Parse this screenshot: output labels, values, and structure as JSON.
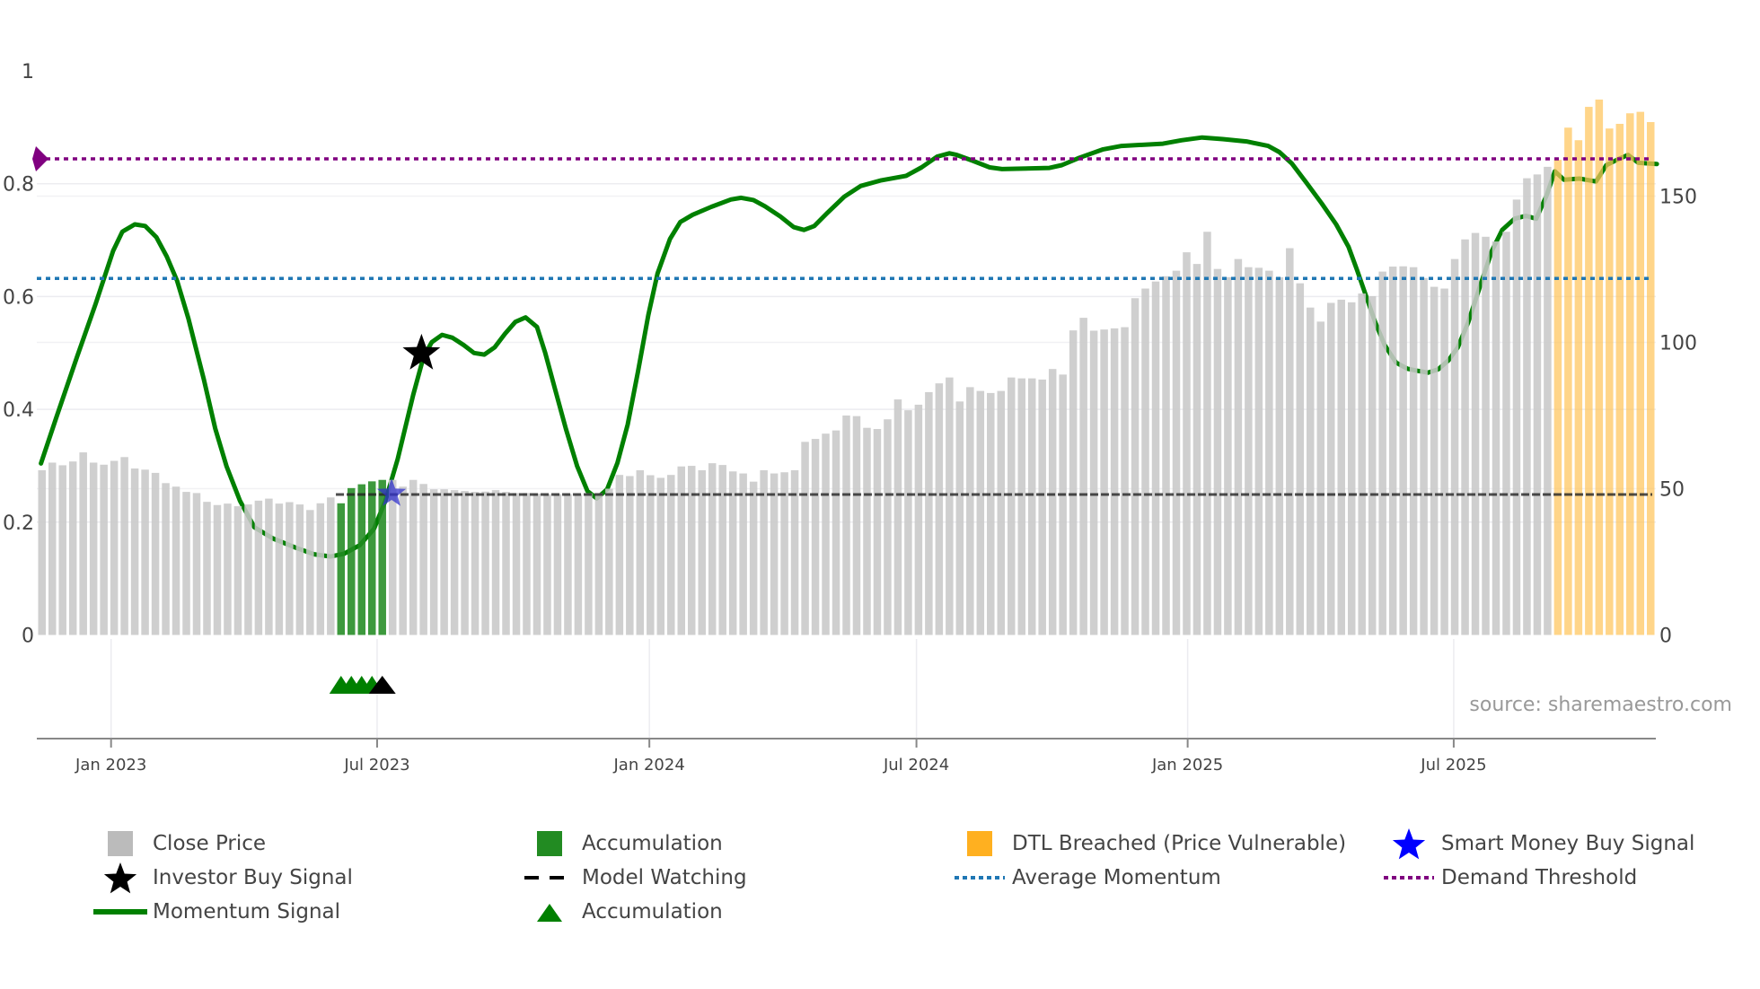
{
  "chart_data": {
    "type": "bar+line",
    "source": "source: sharemaestro.com",
    "left_axis": {
      "range": [
        0,
        1
      ],
      "ticks": [
        "0",
        "0.2",
        "0.4",
        "0.6",
        "0.8",
        "1"
      ],
      "tick_values": [
        0,
        0.2,
        0.4,
        0.6,
        0.8,
        1
      ]
    },
    "right_axis": {
      "range": [
        0,
        192.8
      ],
      "ticks": [
        "0",
        "50",
        "100",
        "150"
      ],
      "tick_values": [
        0,
        50,
        100,
        150
      ]
    },
    "x_axis": {
      "unit": "week index",
      "ticks": [
        {
          "label": "Jan 2023",
          "at": 6.7
        },
        {
          "label": "Jul 2023",
          "at": 32.5
        },
        {
          "label": "Jan 2024",
          "at": 58.9
        },
        {
          "label": "Jul 2024",
          "at": 84.8
        },
        {
          "label": "Jan 2025",
          "at": 111.1
        },
        {
          "label": "Jul 2025",
          "at": 136.9
        }
      ]
    },
    "close_price": [
      56.3,
      58.9,
      58.0,
      59.3,
      62.4,
      58.9,
      58.2,
      59.5,
      60.8,
      56.9,
      56.5,
      55.4,
      51.9,
      50.7,
      48.9,
      48.5,
      45.5,
      44.4,
      44.9,
      44.0,
      44.6,
      45.9,
      46.6,
      44.9,
      45.4,
      44.6,
      42.7,
      45.0,
      47.0,
      45.0,
      50.2,
      51.5,
      52.5,
      53.0,
      53.0,
      50.7,
      53.0,
      51.6,
      49.8,
      49.8,
      49.5,
      49.2,
      48.9,
      49.0,
      49.5,
      48.9,
      48.5,
      48.5,
      48.3,
      48.1,
      48.1,
      48.1,
      47.9,
      48.5,
      48.5,
      50.0,
      54.7,
      54.3,
      56.3,
      54.6,
      53.7,
      54.7,
      57.6,
      57.8,
      56.3,
      58.7,
      58.1,
      55.9,
      55.2,
      52.4,
      56.3,
      55.2,
      55.6,
      56.3,
      66.0,
      67.0,
      68.8,
      69.9,
      75.0,
      74.8,
      70.8,
      70.4,
      73.7,
      80.5,
      76.8,
      78.7,
      83.0,
      86.0,
      88.0,
      79.8,
      84.7,
      83.4,
      82.7,
      83.4,
      88.0,
      87.7,
      87.7,
      87.3,
      90.9,
      89.0,
      104.1,
      108.4,
      104.0,
      104.4,
      104.8,
      105.2,
      115.1,
      118.4,
      120.8,
      122.6,
      124.5,
      130.8,
      126.8,
      137.8,
      125.1,
      122.3,
      128.5,
      125.7,
      125.5,
      124.5,
      122.3,
      132.2,
      120.2,
      111.9,
      107.1,
      113.5,
      114.6,
      113.7,
      116.7,
      115.8,
      124.2,
      125.9,
      126.0,
      125.7,
      122.0,
      119.0,
      118.4,
      128.5,
      135.2,
      137.4,
      136.1,
      134.5,
      137.8,
      148.8,
      156.1,
      157.4,
      160.0,
      162.4,
      173.4,
      169.1,
      180.5,
      183.0,
      173.1,
      174.7,
      178.3,
      178.8,
      175.3
    ],
    "accumulation_bars": [
      29,
      30,
      31,
      32,
      33
    ],
    "dtl_breached_from": 147,
    "momentum": [
      [
        -0.1,
        0.304
      ],
      [
        1.4,
        0.386
      ],
      [
        3.4,
        0.493
      ],
      [
        5.2,
        0.587
      ],
      [
        6.9,
        0.681
      ],
      [
        7.8,
        0.715
      ],
      [
        9.0,
        0.728
      ],
      [
        10.0,
        0.725
      ],
      [
        11.1,
        0.705
      ],
      [
        12.1,
        0.671
      ],
      [
        13.1,
        0.628
      ],
      [
        14.2,
        0.561
      ],
      [
        15.7,
        0.453
      ],
      [
        16.8,
        0.366
      ],
      [
        17.9,
        0.299
      ],
      [
        19.2,
        0.238
      ],
      [
        20.6,
        0.191
      ],
      [
        22.4,
        0.171
      ],
      [
        24.7,
        0.154
      ],
      [
        26.4,
        0.143
      ],
      [
        28.0,
        0.139
      ],
      [
        29.3,
        0.144
      ],
      [
        30.8,
        0.159
      ],
      [
        32.2,
        0.188
      ],
      [
        33.3,
        0.238
      ],
      [
        34.5,
        0.312
      ],
      [
        36.0,
        0.426
      ],
      [
        37.0,
        0.493
      ],
      [
        37.8,
        0.519
      ],
      [
        38.8,
        0.532
      ],
      [
        39.8,
        0.527
      ],
      [
        40.9,
        0.514
      ],
      [
        41.9,
        0.5
      ],
      [
        42.9,
        0.497
      ],
      [
        43.9,
        0.51
      ],
      [
        44.9,
        0.534
      ],
      [
        45.9,
        0.555
      ],
      [
        46.9,
        0.563
      ],
      [
        48.0,
        0.546
      ],
      [
        48.8,
        0.5
      ],
      [
        49.8,
        0.433
      ],
      [
        50.8,
        0.366
      ],
      [
        51.9,
        0.299
      ],
      [
        52.9,
        0.255
      ],
      [
        53.8,
        0.242
      ],
      [
        54.8,
        0.258
      ],
      [
        55.8,
        0.305
      ],
      [
        56.8,
        0.373
      ],
      [
        57.8,
        0.467
      ],
      [
        58.8,
        0.567
      ],
      [
        59.7,
        0.641
      ],
      [
        60.9,
        0.702
      ],
      [
        61.9,
        0.732
      ],
      [
        63.1,
        0.745
      ],
      [
        64.9,
        0.759
      ],
      [
        66.8,
        0.772
      ],
      [
        67.8,
        0.775
      ],
      [
        69.0,
        0.771
      ],
      [
        70.1,
        0.76
      ],
      [
        71.6,
        0.742
      ],
      [
        72.9,
        0.723
      ],
      [
        73.9,
        0.718
      ],
      [
        74.9,
        0.725
      ],
      [
        76.2,
        0.749
      ],
      [
        77.8,
        0.777
      ],
      [
        79.4,
        0.796
      ],
      [
        81.4,
        0.806
      ],
      [
        83.8,
        0.814
      ],
      [
        85.3,
        0.829
      ],
      [
        86.8,
        0.848
      ],
      [
        88.0,
        0.854
      ],
      [
        88.7,
        0.851
      ],
      [
        90.2,
        0.841
      ],
      [
        91.9,
        0.829
      ],
      [
        93.1,
        0.826
      ],
      [
        97.7,
        0.828
      ],
      [
        98.9,
        0.833
      ],
      [
        100.6,
        0.846
      ],
      [
        102.9,
        0.861
      ],
      [
        104.7,
        0.867
      ],
      [
        108.7,
        0.871
      ],
      [
        110.5,
        0.877
      ],
      [
        112.5,
        0.882
      ],
      [
        114.5,
        0.879
      ],
      [
        116.8,
        0.875
      ],
      [
        118.9,
        0.867
      ],
      [
        120.0,
        0.856
      ],
      [
        121.2,
        0.836
      ],
      [
        122.6,
        0.802
      ],
      [
        124.1,
        0.765
      ],
      [
        125.5,
        0.728
      ],
      [
        126.7,
        0.688
      ],
      [
        127.5,
        0.648
      ],
      [
        128.4,
        0.601
      ],
      [
        129.3,
        0.554
      ],
      [
        130.2,
        0.514
      ],
      [
        131.3,
        0.483
      ],
      [
        132.4,
        0.472
      ],
      [
        133.5,
        0.468
      ],
      [
        134.4,
        0.465
      ],
      [
        135.4,
        0.471
      ],
      [
        136.4,
        0.487
      ],
      [
        137.3,
        0.51
      ],
      [
        138.3,
        0.554
      ],
      [
        139.5,
        0.621
      ],
      [
        140.6,
        0.681
      ],
      [
        141.6,
        0.718
      ],
      [
        142.8,
        0.738
      ],
      [
        143.9,
        0.743
      ],
      [
        144.9,
        0.738
      ],
      [
        145.9,
        0.779
      ],
      [
        146.7,
        0.822
      ],
      [
        147.6,
        0.807
      ],
      [
        149.1,
        0.809
      ],
      [
        150.7,
        0.804
      ],
      [
        151.7,
        0.833
      ],
      [
        152.8,
        0.843
      ],
      [
        153.8,
        0.851
      ],
      [
        154.8,
        0.837
      ],
      [
        156.6,
        0.835
      ]
    ],
    "demand_threshold": 0.844,
    "average_momentum": 0.632,
    "model_watching": {
      "price": 48,
      "from": 28.5
    },
    "investor_buy_signal": {
      "at": 36.8,
      "momentum": 0.499
    },
    "smart_money_buy_signal": {
      "at": 33.9,
      "price": 48.3
    },
    "accumulation_markers": {
      "green": [
        29,
        30,
        31,
        32
      ],
      "black": [
        33
      ]
    },
    "colors": {
      "close": "#c8c8c8",
      "accumulation": "#228B22",
      "dtl": "#FFC55C",
      "momentum": "#008000",
      "demand": "#800080",
      "average": "#1f77b4",
      "smart_money": "#0000ff"
    },
    "legend": [
      {
        "label": "Close Price",
        "symbol": "square",
        "color": "#bbbbbb"
      },
      {
        "label": "Accumulation",
        "symbol": "square",
        "color": "#228B22"
      },
      {
        "label": "DTL Breached (Price Vulnerable)",
        "symbol": "square",
        "color": "#FFB020"
      },
      {
        "label": "Smart Money Buy Signal",
        "symbol": "star",
        "color": "#0000ff"
      },
      {
        "label": "Investor Buy Signal",
        "symbol": "star",
        "color": "#000000"
      },
      {
        "label": "Model Watching",
        "symbol": "dash",
        "color": "#000000"
      },
      {
        "label": "Average Momentum",
        "symbol": "dot",
        "color": "#1f77b4"
      },
      {
        "label": "Demand Threshold",
        "symbol": "dot",
        "color": "#800080"
      },
      {
        "label": "Momentum Signal",
        "symbol": "line",
        "color": "#008000"
      },
      {
        "label": "Accumulation",
        "symbol": "triangle",
        "color": "#008000"
      }
    ]
  }
}
